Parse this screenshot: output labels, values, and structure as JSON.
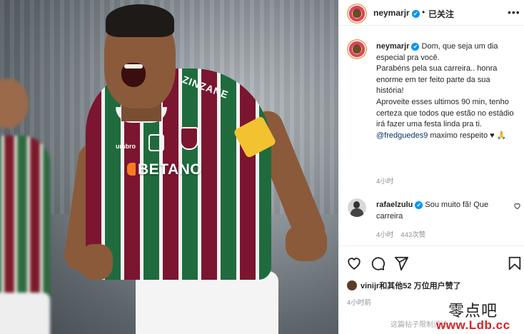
{
  "header": {
    "username": "neymarjr",
    "verified_mark": "✔",
    "separator": "•",
    "follow_status": "已关注",
    "more_icon": "•••"
  },
  "photo": {
    "shirt_sponsor": "BETANO",
    "shirt_top_text": "ZINZANE",
    "kit_brand": "umbro"
  },
  "caption": {
    "username": "neymarjr",
    "lines": [
      "Dom, que seja um dia especial pra você.",
      "Parabéns pela sua carreira.. honra enorme em ter feito parte da sua história!",
      "Aproveite esses ultimos 90 min, tenho certeza que todos que estão no estádio irá fazer uma festa linda pra ti."
    ],
    "mention": "@fredguedes9",
    "closing": " maximo respeito ♥ 🙏",
    "time": "4小时"
  },
  "comment": {
    "username": "rafaelzulu",
    "text": " Sou muito fã! Que carreira",
    "time": "4小时",
    "likes": "443次赞"
  },
  "actions": {
    "like_icon": "heart-icon",
    "comment_icon": "comment-icon",
    "share_icon": "share-icon",
    "save_icon": "bookmark-icon"
  },
  "likes_summary": {
    "text": "vinijr和其他52 万位用户赞了"
  },
  "post_time": "4小时前",
  "footer_note": "这篇帖子限制评论",
  "watermark": {
    "cn": "零点吧",
    "url": "www.Ldb.cc"
  },
  "colors": {
    "verified": "#0095f6",
    "mention": "#00376b",
    "secondary_text": "#8e8e8e",
    "watermark_url": "#d8202a"
  }
}
